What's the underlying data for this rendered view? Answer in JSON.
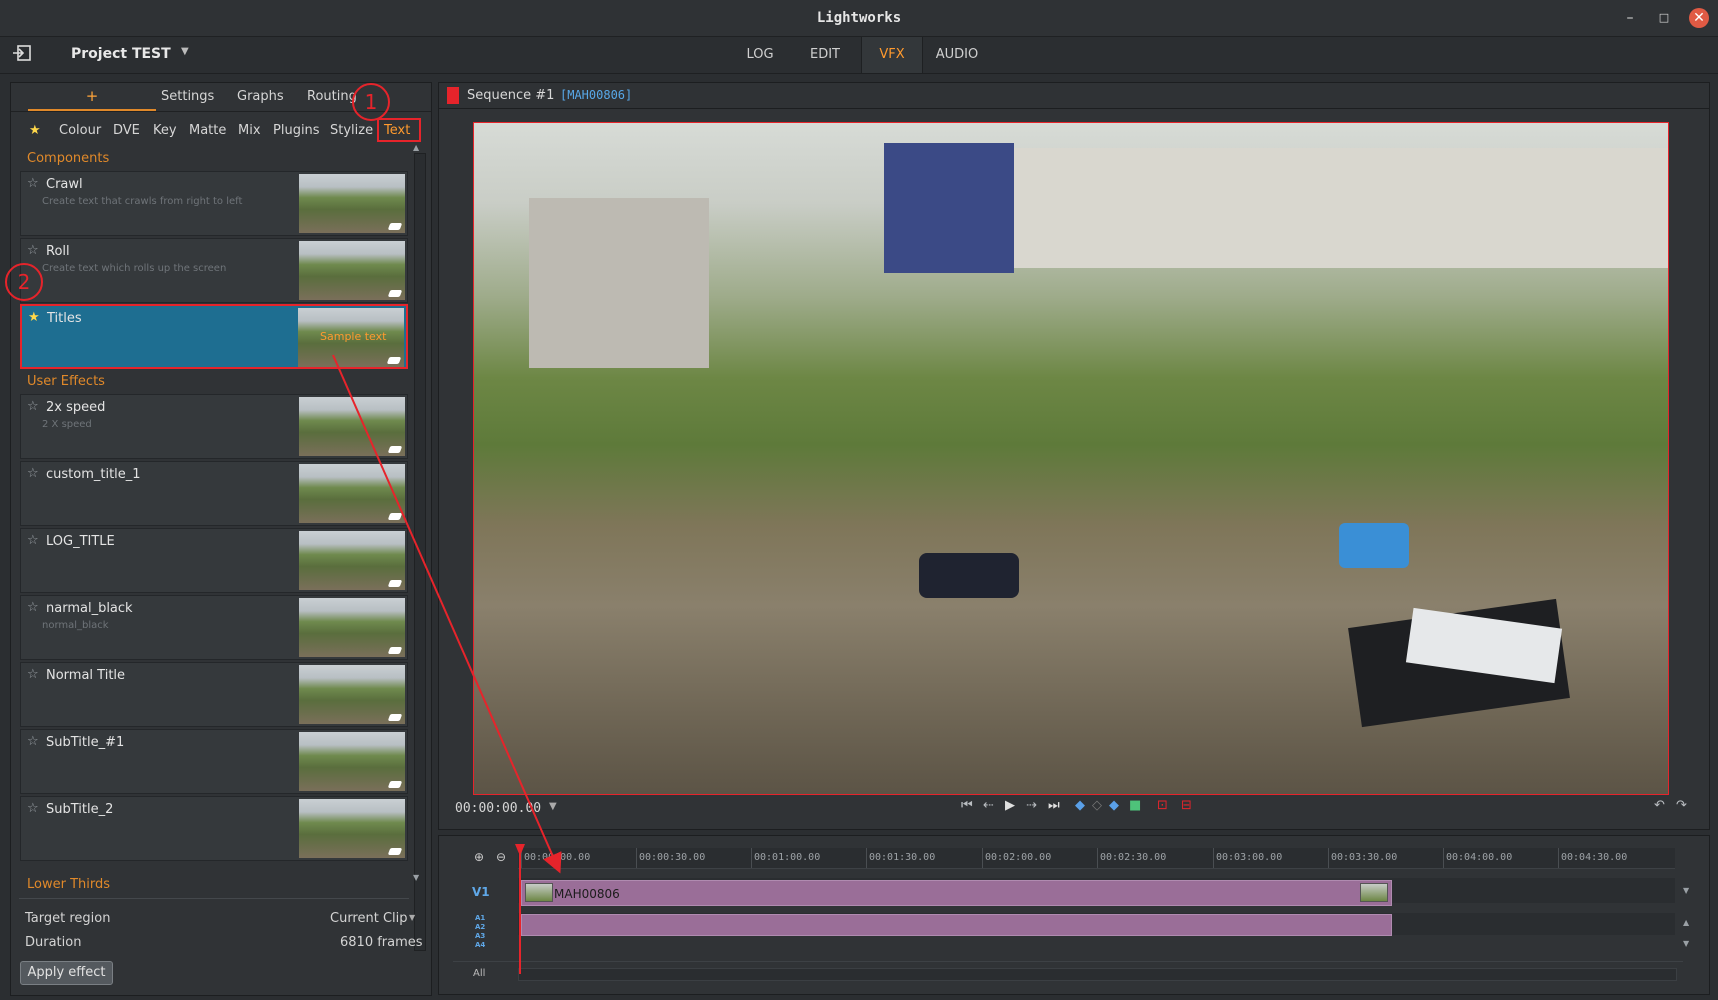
{
  "window": {
    "title": "Lightworks",
    "minimize": "–",
    "maximize": "□",
    "close": "✕"
  },
  "menubar": {
    "project_name": "Project TEST",
    "project_dropdown": "▼",
    "tabs": [
      "LOG",
      "EDIT",
      "VFX",
      "AUDIO"
    ],
    "active_tab": "VFX"
  },
  "effects_panel": {
    "tabs": [
      "+",
      "Settings",
      "Graphs",
      "Routing"
    ],
    "categories": [
      "★",
      "Colour",
      "DVE",
      "Key",
      "Matte",
      "Mix",
      "Plugins",
      "Stylize",
      "Text"
    ],
    "selected_category": "Text",
    "sections": {
      "components": "Components",
      "user_effects": "User Effects",
      "lower_thirds": "Lower Thirds"
    },
    "components": [
      {
        "name": "Crawl",
        "description": "Create text that crawls from right to left",
        "starred": false
      },
      {
        "name": "Roll",
        "description": "Create text which rolls up the screen",
        "starred": false
      },
      {
        "name": "Titles",
        "description": "",
        "starred": true,
        "selected": true,
        "thumb_text": "Sample text"
      }
    ],
    "user_effects": [
      {
        "name": "2x speed",
        "description": "2 X speed"
      },
      {
        "name": "custom_title_1",
        "description": ""
      },
      {
        "name": "LOG_TITLE",
        "description": ""
      },
      {
        "name": "narmal_black",
        "description": "normal_black"
      },
      {
        "name": "Normal Title",
        "description": ""
      },
      {
        "name": "SubTitle_#1",
        "description": ""
      },
      {
        "name": "SubTitle_2",
        "description": ""
      }
    ],
    "target_region_label": "Target region",
    "target_region_value": "Current Clip",
    "duration_label": "Duration",
    "duration_value": "6810 frames",
    "apply_button": "Apply effect",
    "annotations": [
      "1",
      "2"
    ]
  },
  "viewer": {
    "sequence_title": "Sequence #1",
    "sequence_clip": "[MAH00806]",
    "timecode": "00:00:00.00",
    "controls": [
      "first-icon",
      "step-back-icon",
      "play-icon",
      "step-forward-icon",
      "last-icon",
      "mark-in-icon",
      "clear-mark-icon",
      "mark-out-icon",
      "marker-icon",
      "lift-icon",
      "remove-icon"
    ]
  },
  "timeline": {
    "ticks": [
      "00:00:00.00",
      "00:00:30.00",
      "00:01:00.00",
      "00:01:30.00",
      "00:02:00.00",
      "00:02:30.00",
      "00:03:00.00",
      "00:03:30.00",
      "00:04:00.00",
      "00:04:30.00"
    ],
    "video_track": "V1",
    "audio_tracks": [
      "A1",
      "A2",
      "A3",
      "A4"
    ],
    "all_label": "All",
    "clip_name": "MAH00806"
  }
}
